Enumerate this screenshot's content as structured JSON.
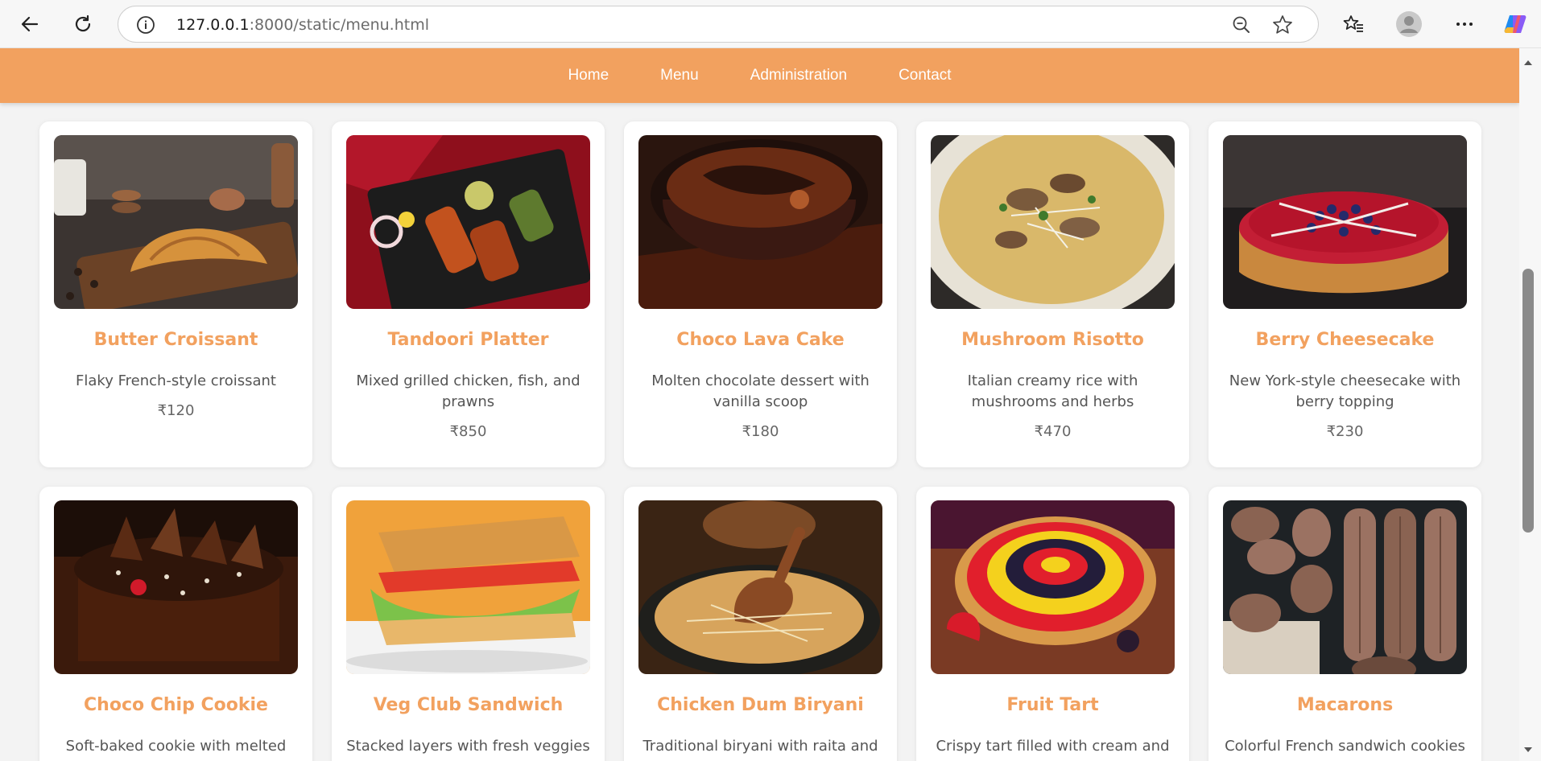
{
  "browser": {
    "url_host": "127.0.0.1",
    "url_rest": ":8000/static/menu.html",
    "icons": [
      "back-arrow-icon",
      "refresh-icon",
      "info-icon",
      "zoom-out-icon",
      "star-icon",
      "favorites-icon",
      "profile-avatar",
      "more-icon",
      "copilot-icon"
    ]
  },
  "nav": {
    "items": [
      "Home",
      "Menu",
      "Administration",
      "Contact"
    ]
  },
  "colors": {
    "accent": "#f2a15f",
    "card_bg": "#ffffff",
    "page_bg": "#f3f3f3"
  },
  "menu": {
    "row1": [
      {
        "name": "Butter Croissant",
        "desc": "Flaky French-style croissant",
        "price": "₹120"
      },
      {
        "name": "Tandoori Platter",
        "desc": "Mixed grilled chicken, fish, and prawns",
        "price": "₹850"
      },
      {
        "name": "Choco Lava Cake",
        "desc": "Molten chocolate dessert with vanilla scoop",
        "price": "₹180"
      },
      {
        "name": "Mushroom Risotto",
        "desc": "Italian creamy rice with mushrooms and herbs",
        "price": "₹470"
      },
      {
        "name": "Berry Cheesecake",
        "desc": "New York-style cheesecake with berry topping",
        "price": "₹230"
      }
    ],
    "row2": [
      {
        "name": "Choco Chip Cookie",
        "desc": "Soft-baked cookie with melted"
      },
      {
        "name": "Veg Club Sandwich",
        "desc": "Stacked layers with fresh veggies"
      },
      {
        "name": "Chicken Dum Biryani",
        "desc": "Traditional biryani with raita and"
      },
      {
        "name": "Fruit Tart",
        "desc": "Crispy tart filled with cream and"
      },
      {
        "name": "Macarons",
        "desc": "Colorful French sandwich cookies"
      }
    ]
  }
}
